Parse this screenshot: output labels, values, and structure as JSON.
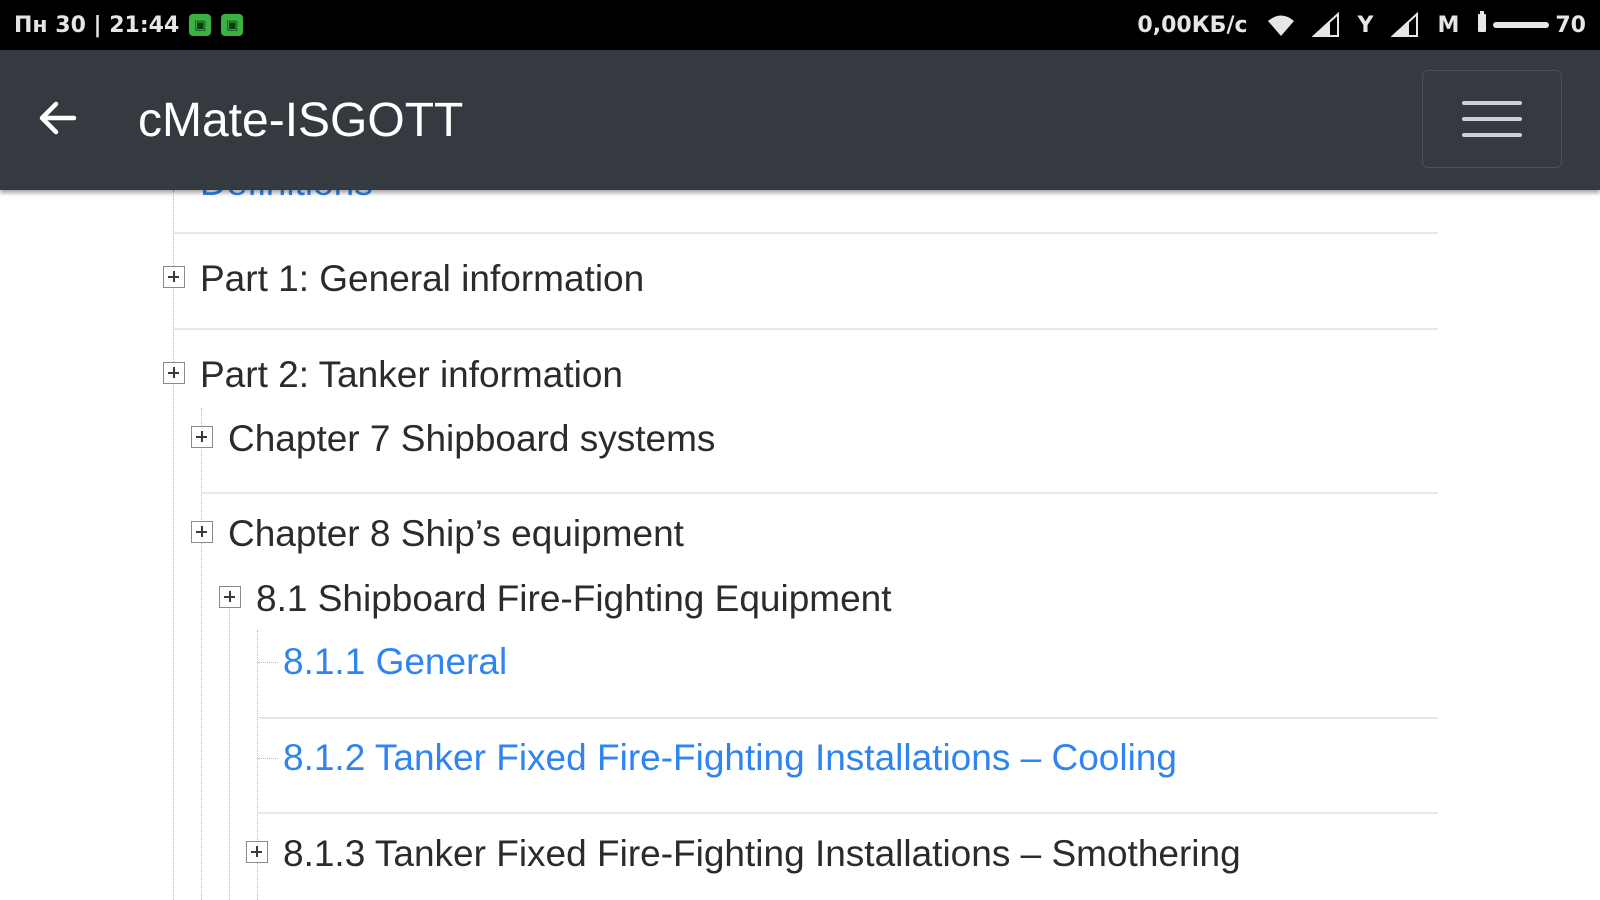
{
  "status_bar": {
    "datetime": "Пн 30 | 21:44",
    "network_speed": "0,00КБ/с",
    "carrier1": "Y",
    "carrier2": "M",
    "battery": "70",
    "colors": {
      "background": "#000000",
      "notification_badge": "#3cb043"
    }
  },
  "app_bar": {
    "title": "cMate-ISGOTT",
    "colors": {
      "background": "#343a40"
    }
  },
  "tree": {
    "partial_item": "Definitions",
    "items": [
      {
        "label": "Part 1: General information",
        "type": "expandable"
      },
      {
        "label": "Part 2: Tanker information",
        "type": "expandable"
      },
      {
        "label": "Chapter 7 Shipboard systems",
        "type": "expandable"
      },
      {
        "label": "Chapter 8 Ship’s equipment",
        "type": "expandable"
      },
      {
        "label": "8.1 Shipboard Fire-Fighting Equipment",
        "type": "expandable"
      },
      {
        "label": "8.1.1 General",
        "type": "link"
      },
      {
        "label": "8.1.2 Tanker Fixed Fire-Fighting Installations – Cooling",
        "type": "link"
      },
      {
        "label": "8.1.3 Tanker Fixed Fire-Fighting Installations – Smothering",
        "type": "expandable"
      }
    ],
    "colors": {
      "link": "#2f84f0",
      "text": "#2b2b2b"
    }
  }
}
